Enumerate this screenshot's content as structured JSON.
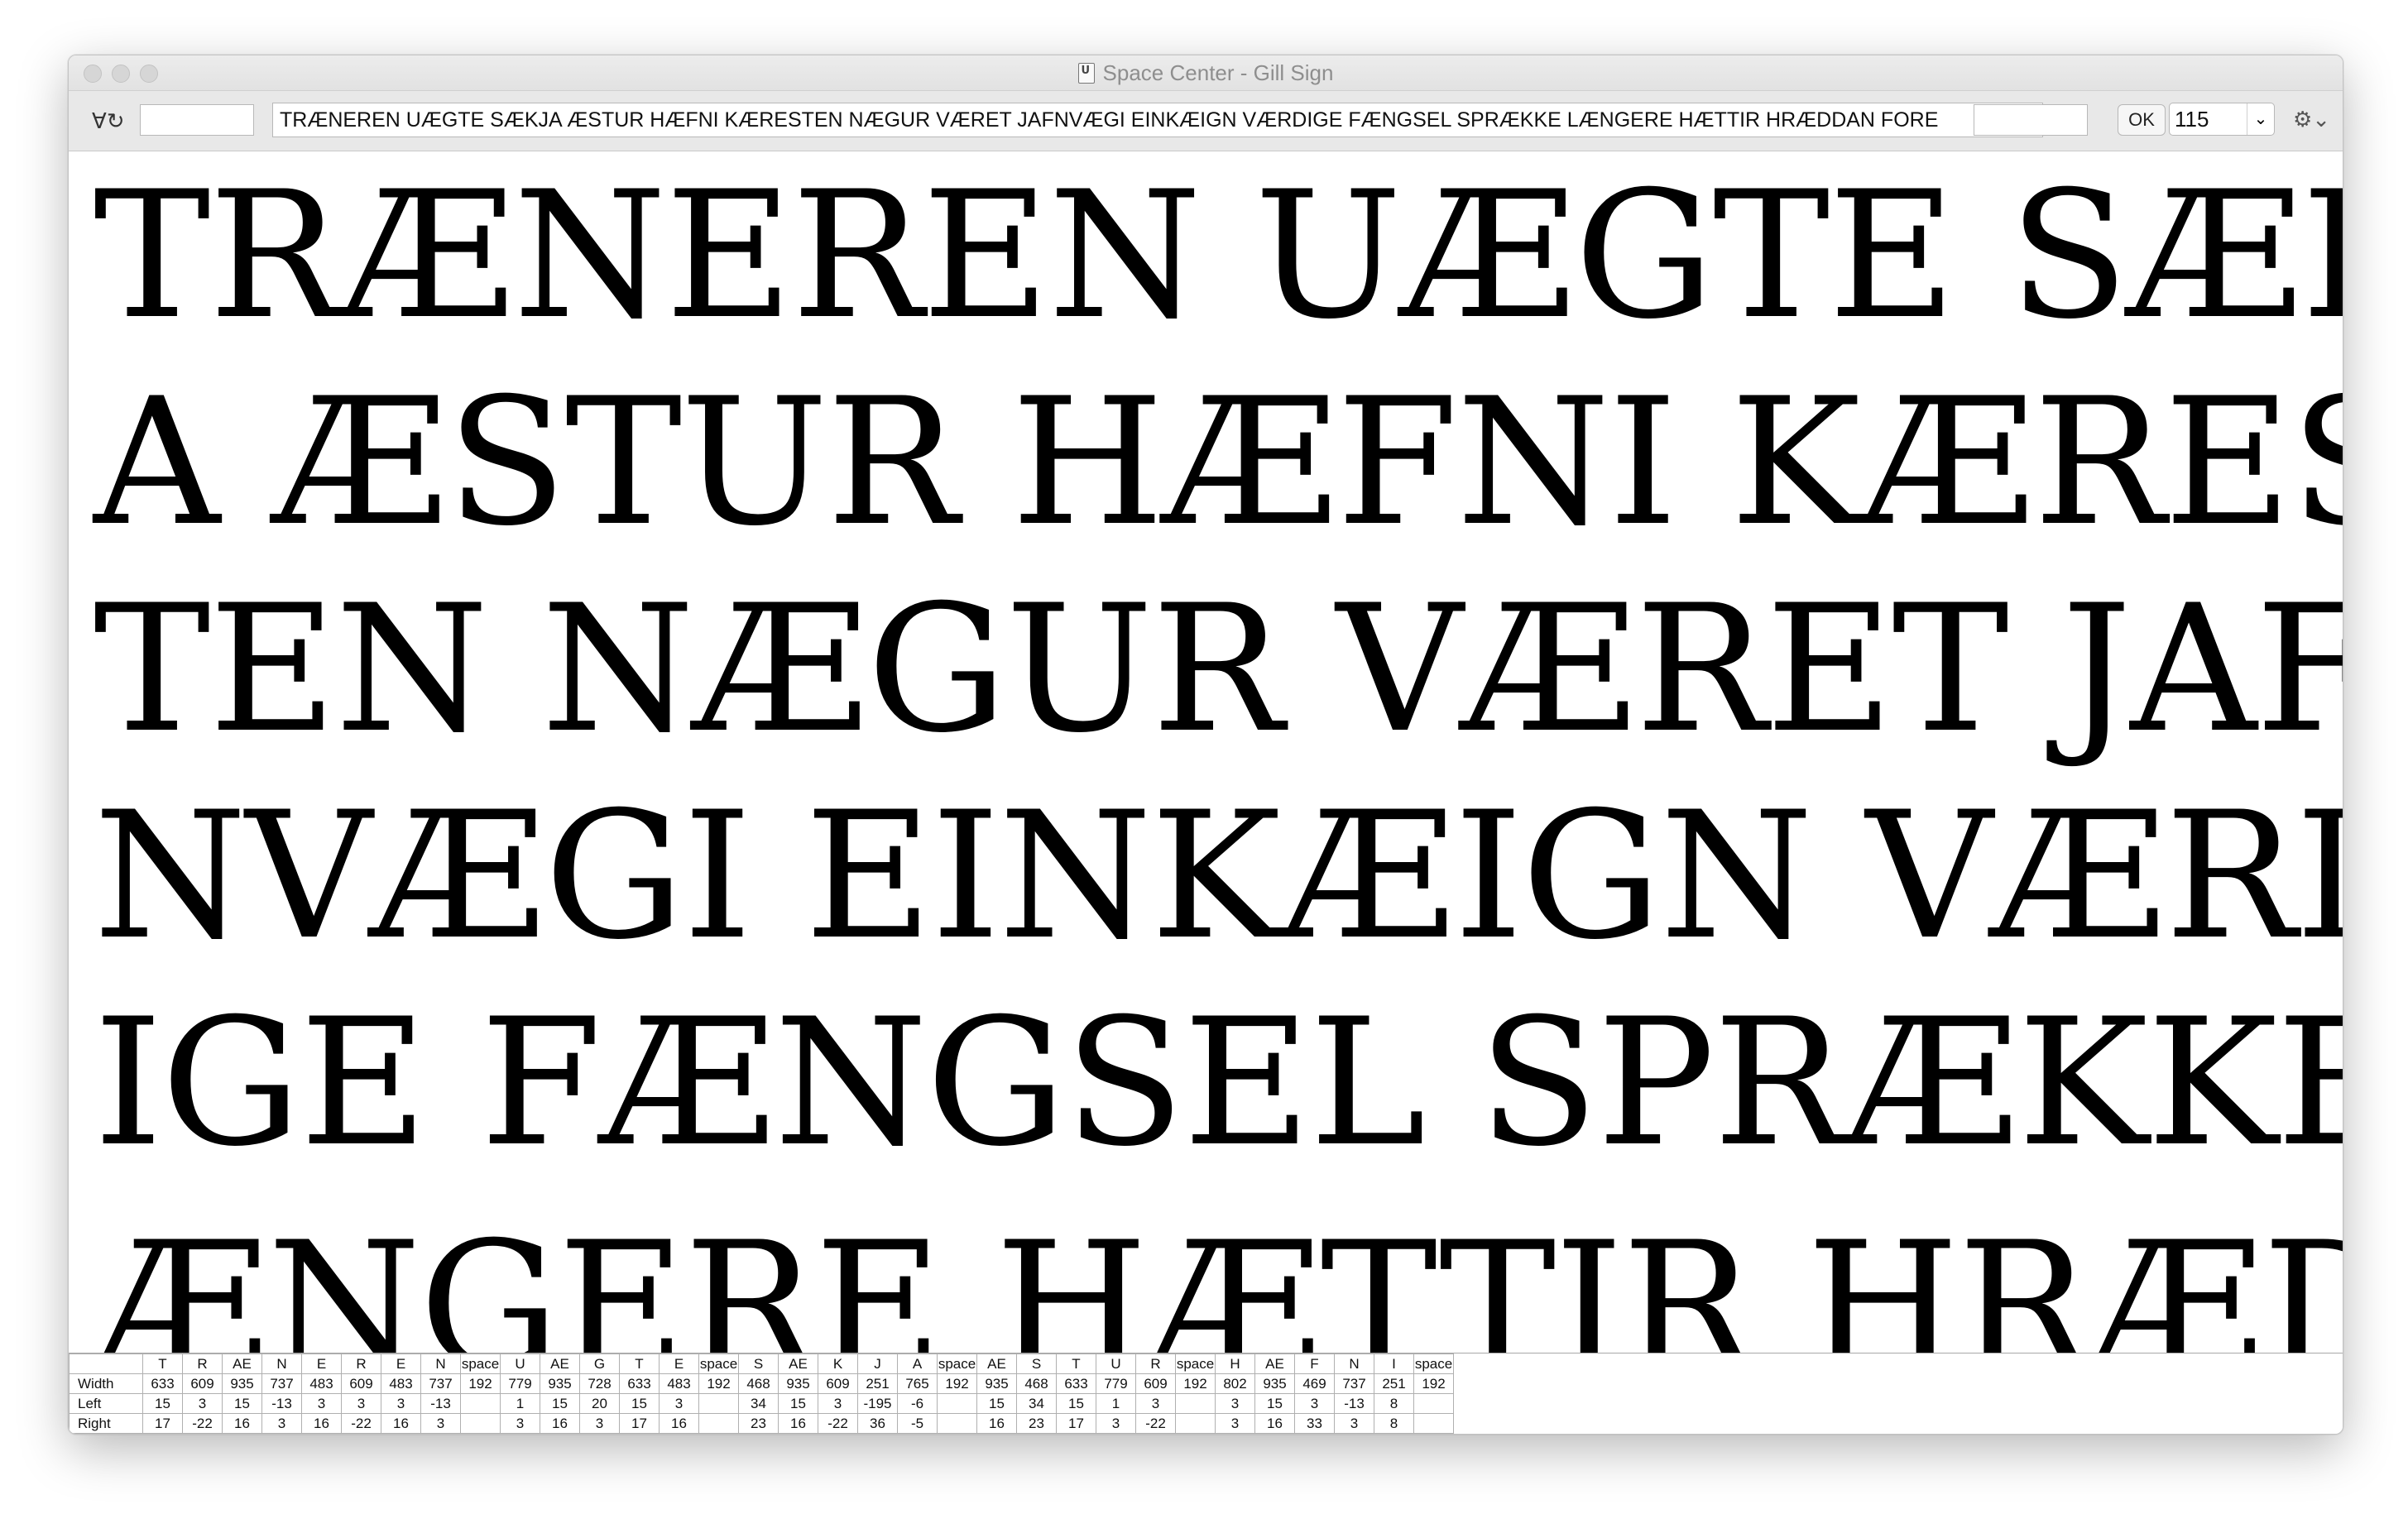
{
  "window": {
    "title": "Space Center - Gill Sign",
    "file_icon": "ufo-document-icon"
  },
  "toolbar": {
    "glyph_icon_text": "∀↻",
    "left_field_value": "",
    "text_field_value": "TRÆNEREN UÆGTE SÆKJA ÆSTUR HÆFNI KÆRESTEN NÆGUR VÆRET JAFNVÆGI EINKÆIGN VÆRDIGE FÆNGSEL SPRÆKKE LÆNGERE HÆTTIR HRÆDDAN FORE",
    "right_field_value": "",
    "ok_label": "OK",
    "point_size": "115",
    "chevron_glyph": "⌄",
    "gear_glyph": "⚙⌄"
  },
  "preview": {
    "lines": [
      "TRÆNEREN UÆGTE SÆKJ",
      "A ÆSTUR HÆFNI KÆRES",
      "TEN NÆGUR VÆRET JAF",
      "NVÆGI EINKÆIGN VÆRD",
      "IGE FÆNGSEL SPRÆKKE L",
      "ÆNGERE HÆTTIR HRÆD"
    ]
  },
  "metrics": {
    "row_labels": [
      "Width",
      "Left",
      "Right"
    ],
    "glyphs": [
      {
        "name": "T",
        "width": "633",
        "left": "15",
        "right": "17"
      },
      {
        "name": "R",
        "width": "609",
        "left": "3",
        "right": "-22"
      },
      {
        "name": "AE",
        "width": "935",
        "left": "15",
        "right": "16"
      },
      {
        "name": "N",
        "width": "737",
        "left": "-13",
        "right": "3"
      },
      {
        "name": "E",
        "width": "483",
        "left": "3",
        "right": "16"
      },
      {
        "name": "R",
        "width": "609",
        "left": "3",
        "right": "-22"
      },
      {
        "name": "E",
        "width": "483",
        "left": "3",
        "right": "16"
      },
      {
        "name": "N",
        "width": "737",
        "left": "-13",
        "right": "3"
      },
      {
        "name": "space",
        "width": "192",
        "left": "",
        "right": ""
      },
      {
        "name": "U",
        "width": "779",
        "left": "1",
        "right": "3"
      },
      {
        "name": "AE",
        "width": "935",
        "left": "15",
        "right": "16"
      },
      {
        "name": "G",
        "width": "728",
        "left": "20",
        "right": "3"
      },
      {
        "name": "T",
        "width": "633",
        "left": "15",
        "right": "17"
      },
      {
        "name": "E",
        "width": "483",
        "left": "3",
        "right": "16"
      },
      {
        "name": "space",
        "width": "192",
        "left": "",
        "right": ""
      },
      {
        "name": "S",
        "width": "468",
        "left": "34",
        "right": "23"
      },
      {
        "name": "AE",
        "width": "935",
        "left": "15",
        "right": "16"
      },
      {
        "name": "K",
        "width": "609",
        "left": "3",
        "right": "-22"
      },
      {
        "name": "J",
        "width": "251",
        "left": "-195",
        "right": "36"
      },
      {
        "name": "A",
        "width": "765",
        "left": "-6",
        "right": "-5"
      },
      {
        "name": "space",
        "width": "192",
        "left": "",
        "right": ""
      },
      {
        "name": "AE",
        "width": "935",
        "left": "15",
        "right": "16"
      },
      {
        "name": "S",
        "width": "468",
        "left": "34",
        "right": "23"
      },
      {
        "name": "T",
        "width": "633",
        "left": "15",
        "right": "17"
      },
      {
        "name": "U",
        "width": "779",
        "left": "1",
        "right": "3"
      },
      {
        "name": "R",
        "width": "609",
        "left": "3",
        "right": "-22"
      },
      {
        "name": "space",
        "width": "192",
        "left": "",
        "right": ""
      },
      {
        "name": "H",
        "width": "802",
        "left": "3",
        "right": "3"
      },
      {
        "name": "AE",
        "width": "935",
        "left": "15",
        "right": "16"
      },
      {
        "name": "F",
        "width": "469",
        "left": "3",
        "right": "33"
      },
      {
        "name": "N",
        "width": "737",
        "left": "-13",
        "right": "3"
      },
      {
        "name": "I",
        "width": "251",
        "left": "8",
        "right": "8"
      },
      {
        "name": "space",
        "width": "192",
        "left": "",
        "right": ""
      }
    ]
  }
}
